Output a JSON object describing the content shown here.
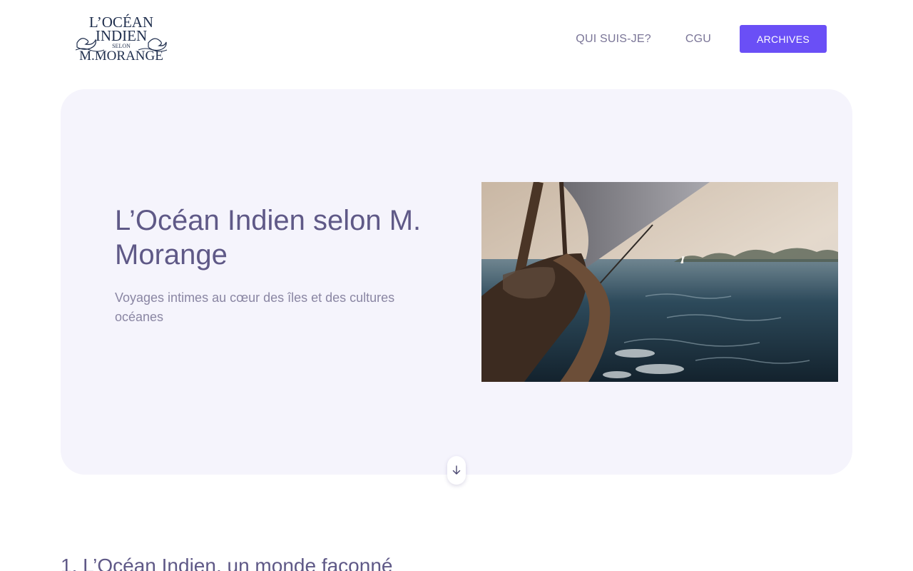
{
  "header": {
    "logo": {
      "line1": "L’OCÉAN",
      "line2": "INDIEN",
      "line3": "SELON",
      "line4": "M.MORANGE"
    },
    "nav": {
      "about_label": "QUI SUIS-JE?",
      "terms_label": "CGU",
      "archives_label": "ARCHIVES"
    }
  },
  "hero": {
    "title": "L’Océan Indien selon M. Morange",
    "subtitle": "Voyages intimes au cœur des îles et des cultures océanes",
    "image_icon": "sailboat-photo",
    "scroll_icon": "arrow-down-icon"
  },
  "section": {
    "heading": "1. L’Océan Indien, un monde façonné"
  },
  "colors": {
    "accent": "#6a4ff6",
    "hero_background": "#f5f4fc",
    "heading_text": "#5f5987",
    "muted_text": "#8a86a3"
  }
}
